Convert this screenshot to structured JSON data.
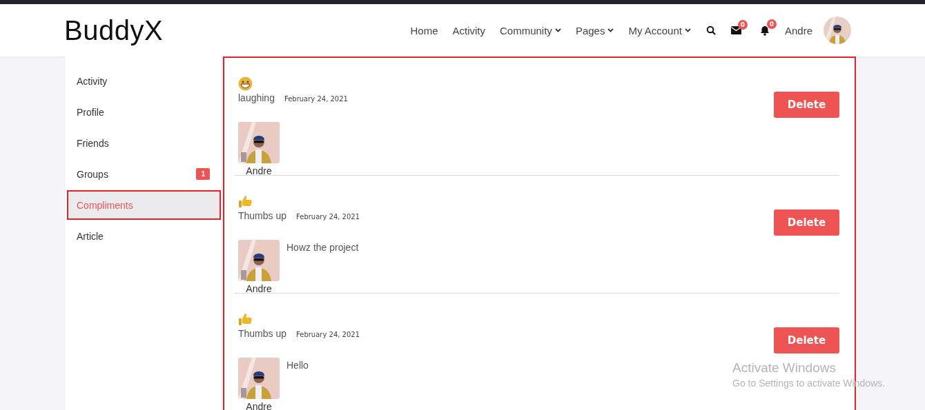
{
  "header": {
    "logo": "BuddyX",
    "nav": [
      {
        "label": "Home",
        "dropdown": false
      },
      {
        "label": "Activity",
        "dropdown": false
      },
      {
        "label": "Community",
        "dropdown": true
      },
      {
        "label": "Pages",
        "dropdown": true
      },
      {
        "label": "My Account",
        "dropdown": true
      }
    ],
    "messages_count": "0",
    "notifications_count": "0",
    "user_name": "Andre"
  },
  "sidebar": {
    "items": [
      {
        "label": "Activity",
        "selected": false
      },
      {
        "label": "Profile",
        "selected": false
      },
      {
        "label": "Friends",
        "selected": false
      },
      {
        "label": "Groups",
        "selected": false,
        "badge": "1"
      },
      {
        "label": "Compliments",
        "selected": true
      },
      {
        "label": "Article",
        "selected": false
      }
    ]
  },
  "compliments": [
    {
      "kind": "laughing",
      "title": "laughing",
      "date": "February 24, 2021",
      "sender": "Andre",
      "button": "Delete"
    },
    {
      "kind": "thumbs",
      "title": "Thumbs up",
      "date": "February 24, 2021",
      "message": "Howz the project",
      "sender": "Andre",
      "button": "Delete"
    },
    {
      "kind": "thumbs",
      "title": "Thumbs up",
      "date": "February 24, 2021",
      "message": "Hello",
      "sender": "Andre",
      "button": "Delete"
    }
  ],
  "os_notice": {
    "title": "Activate Windows",
    "text": "Go to Settings to activate Windows."
  }
}
